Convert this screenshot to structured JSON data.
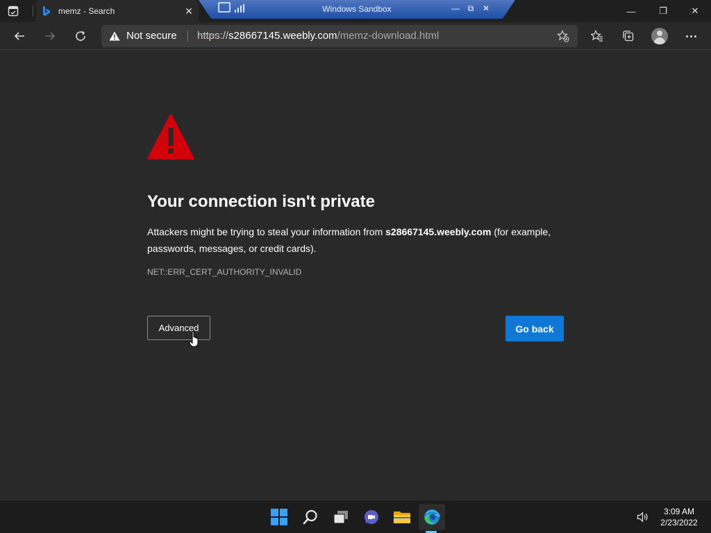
{
  "browser": {
    "tab": {
      "title": "memz - Search",
      "close_label": "✕"
    },
    "window_controls": {
      "minimize": "—",
      "restore": "❐",
      "close": "✕"
    }
  },
  "sandbox": {
    "title": "Windows Sandbox",
    "buttons": {
      "minimize": "—",
      "restore": "⧉",
      "close": "✕"
    }
  },
  "address_bar": {
    "security_label": "Not secure",
    "url_scheme": "https",
    "url_separator": "://",
    "url_host": "s28667145.weebly.com",
    "url_path": "/memz-download.html"
  },
  "page": {
    "heading": "Your connection isn't private",
    "description_before": "Attackers might be trying to steal your information from ",
    "description_host": "s28667145.weebly.com",
    "description_after": " (for example, passwords, messages, or credit cards).",
    "error_code": "NET::ERR_CERT_AUTHORITY_INVALID",
    "advanced_label": "Advanced",
    "go_back_label": "Go back"
  },
  "colors": {
    "warning_red": "#d4000a",
    "primary_blue": "#0f78d4"
  },
  "taskbar": {
    "apps": [
      "start-icon",
      "search-icon",
      "task-view-icon",
      "teams-chat-icon",
      "file-explorer-icon",
      "edge-icon"
    ],
    "active_app": "edge-icon",
    "time": "3:09 AM",
    "date": "2/23/2022"
  }
}
